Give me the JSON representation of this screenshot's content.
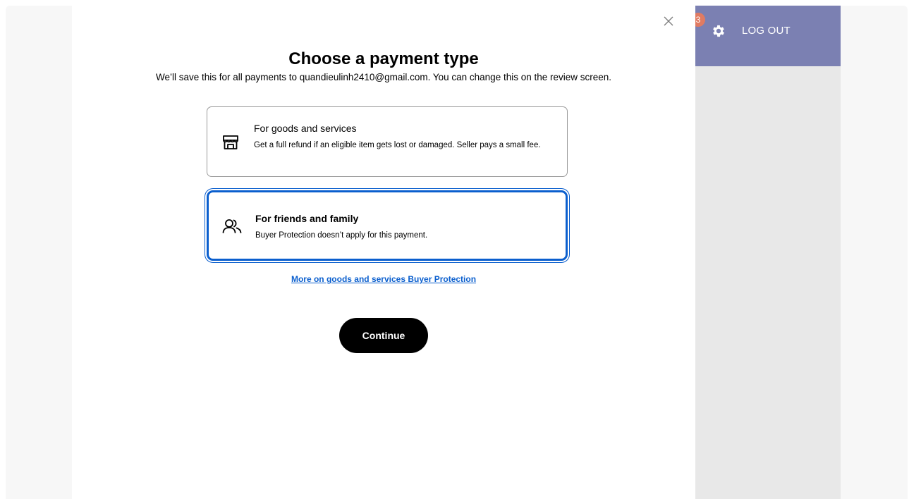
{
  "modal": {
    "title": "Choose a payment type",
    "subtitle": "We’ll save this for all payments to quandieulinh2410@gmail.com. You can change this on the review screen.",
    "options": [
      {
        "icon": "storefront-icon",
        "title": "For goods and services",
        "description": "Get a full refund if an eligible item gets lost or damaged. Seller pays a small fee.",
        "selected": false
      },
      {
        "icon": "people-icon",
        "title": "For friends and family",
        "description": "Buyer Protection doesn’t apply for this payment.",
        "selected": true
      }
    ],
    "more_link": "More on goods and services Buyer Protection",
    "continue_label": "Continue",
    "close_icon": "close-icon"
  },
  "side_panel": {
    "notification_count": "3",
    "settings_icon": "gear-icon",
    "logout_label": "LOG OUT"
  },
  "colors": {
    "accent_blue": "#0b5fce",
    "header_purple": "#7b80b2",
    "badge_orange": "#e07b62"
  }
}
